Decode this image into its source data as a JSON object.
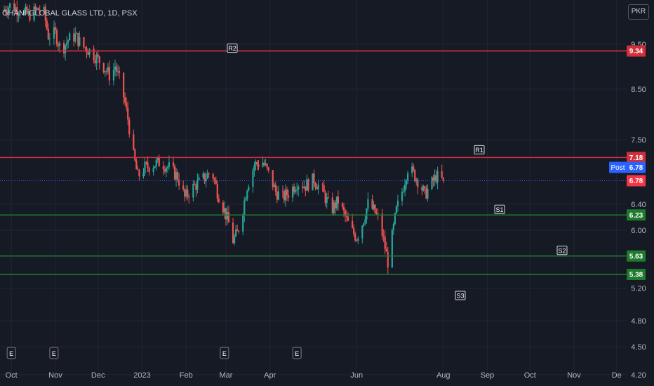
{
  "header": {
    "symbol_title": "GHANI GLOBAL GLASS LTD, 1D, PSX",
    "currency": "PKR"
  },
  "colors": {
    "background": "#161a25",
    "grid": "#232632",
    "up": "#26a69a",
    "down": "#ef5350",
    "resistance": "#d12f3a",
    "support": "#1e7a2d",
    "post_badge": "#2962ff",
    "last_price_badge": "#f23645",
    "axis_text": "#b2b5be"
  },
  "chart_data": {
    "type": "candlestick",
    "title": "GHANI GLOBAL GLASS LTD, 1D, PSX",
    "currency": "PKR",
    "x_axis": {
      "tick_labels": [
        "Oct",
        "Nov",
        "Dec",
        "2023",
        "Feb",
        "Mar",
        "Apr",
        "Jun",
        "Aug",
        "Sep",
        "Oct",
        "Nov",
        "De"
      ],
      "tick_dates": [
        "2022-10-01",
        "2022-11-01",
        "2022-12-01",
        "2023-01-01",
        "2023-02-01",
        "2023-03-01",
        "2023-04-01",
        "2023-06-01",
        "2023-08-01",
        "2023-09-01",
        "2023-10-01",
        "2023-11-01",
        "2023-12-01"
      ]
    },
    "y_axis": {
      "scale": "log",
      "tick_labels": [
        "9.50",
        "8.50",
        "7.50",
        "6.40",
        "6.00",
        "5.20",
        "4.80",
        "4.50",
        "4.20"
      ],
      "range": [
        4.12,
        10.5
      ]
    },
    "grid": true,
    "levels": [
      {
        "name": "R2",
        "value": 9.34,
        "label": "9.34",
        "kind": "resistance"
      },
      {
        "name": "R1",
        "value": 7.18,
        "label": "7.18",
        "kind": "resistance"
      },
      {
        "name": "S1",
        "value": 6.23,
        "label": "6.23",
        "kind": "support"
      },
      {
        "name": "S2",
        "value": 5.63,
        "label": "5.63",
        "kind": "support"
      },
      {
        "name": "S3",
        "value": 5.38,
        "label": "5.38",
        "kind": "support"
      }
    ],
    "post_market": {
      "label": "Post",
      "value": 6.78,
      "value_label": "6.78"
    },
    "last_price": {
      "value": 6.78,
      "label": "6.78"
    },
    "events": [
      {
        "label": "E",
        "date": "2022-10-01"
      },
      {
        "label": "E",
        "date": "2022-10-31"
      },
      {
        "label": "E",
        "date": "2023-02-28"
      },
      {
        "label": "E",
        "date": "2023-04-20"
      }
    ],
    "price_path": [
      [
        "2022-09-24",
        10.3
      ],
      [
        "2022-09-30",
        10.45
      ],
      [
        "2022-10-06",
        10.35
      ],
      [
        "2022-10-13",
        10.2
      ],
      [
        "2022-10-20",
        10.35
      ],
      [
        "2022-10-24",
        10.25
      ],
      [
        "2022-10-27",
        9.7
      ],
      [
        "2022-11-01",
        9.75
      ],
      [
        "2022-11-05",
        9.35
      ],
      [
        "2022-11-10",
        9.6
      ],
      [
        "2022-11-15",
        9.7
      ],
      [
        "2022-11-20",
        9.45
      ],
      [
        "2022-11-25",
        9.35
      ],
      [
        "2022-12-01",
        9.15
      ],
      [
        "2022-12-06",
        8.95
      ],
      [
        "2022-12-10",
        8.75
      ],
      [
        "2022-12-13",
        9.0
      ],
      [
        "2022-12-15",
        8.8
      ],
      [
        "2022-12-18",
        8.5
      ],
      [
        "2022-12-22",
        7.9
      ],
      [
        "2022-12-26",
        7.2
      ],
      [
        "2022-12-29",
        6.85
      ],
      [
        "2023-01-03",
        7.0
      ],
      [
        "2023-01-08",
        7.05
      ],
      [
        "2023-01-14",
        7.1
      ],
      [
        "2023-01-20",
        7.0
      ],
      [
        "2023-01-26",
        6.85
      ],
      [
        "2023-01-31",
        6.5
      ],
      [
        "2023-02-05",
        6.65
      ],
      [
        "2023-02-10",
        6.75
      ],
      [
        "2023-02-15",
        6.85
      ],
      [
        "2023-02-19",
        6.95
      ],
      [
        "2023-02-23",
        6.6
      ],
      [
        "2023-02-28",
        6.3
      ],
      [
        "2023-03-03",
        6.1
      ],
      [
        "2023-03-06",
        5.85
      ],
      [
        "2023-03-09",
        5.95
      ],
      [
        "2023-03-12",
        6.2
      ],
      [
        "2023-03-16",
        6.7
      ],
      [
        "2023-03-21",
        7.05
      ],
      [
        "2023-03-27",
        7.1
      ],
      [
        "2023-04-01",
        6.85
      ],
      [
        "2023-04-05",
        6.6
      ],
      [
        "2023-04-10",
        6.5
      ],
      [
        "2023-04-15",
        6.6
      ],
      [
        "2023-04-20",
        6.75
      ],
      [
        "2023-04-26",
        6.7
      ],
      [
        "2023-05-02",
        6.8
      ],
      [
        "2023-05-08",
        6.6
      ],
      [
        "2023-05-14",
        6.3
      ],
      [
        "2023-05-19",
        6.45
      ],
      [
        "2023-05-24",
        6.2
      ],
      [
        "2023-05-28",
        6.0
      ],
      [
        "2023-06-01",
        5.9
      ],
      [
        "2023-06-05",
        6.1
      ],
      [
        "2023-06-09",
        6.4
      ],
      [
        "2023-06-13",
        6.3
      ],
      [
        "2023-06-17",
        6.15
      ],
      [
        "2023-06-20",
        5.85
      ],
      [
        "2023-06-23",
        5.55
      ],
      [
        "2023-06-26",
        5.9
      ],
      [
        "2023-06-29",
        6.3
      ],
      [
        "2023-07-03",
        6.6
      ],
      [
        "2023-07-07",
        7.0
      ],
      [
        "2023-07-11",
        6.9
      ],
      [
        "2023-07-15",
        6.75
      ],
      [
        "2023-07-19",
        6.55
      ],
      [
        "2023-07-23",
        6.7
      ],
      [
        "2023-07-27",
        6.85
      ],
      [
        "2023-08-01",
        6.78
      ]
    ]
  }
}
